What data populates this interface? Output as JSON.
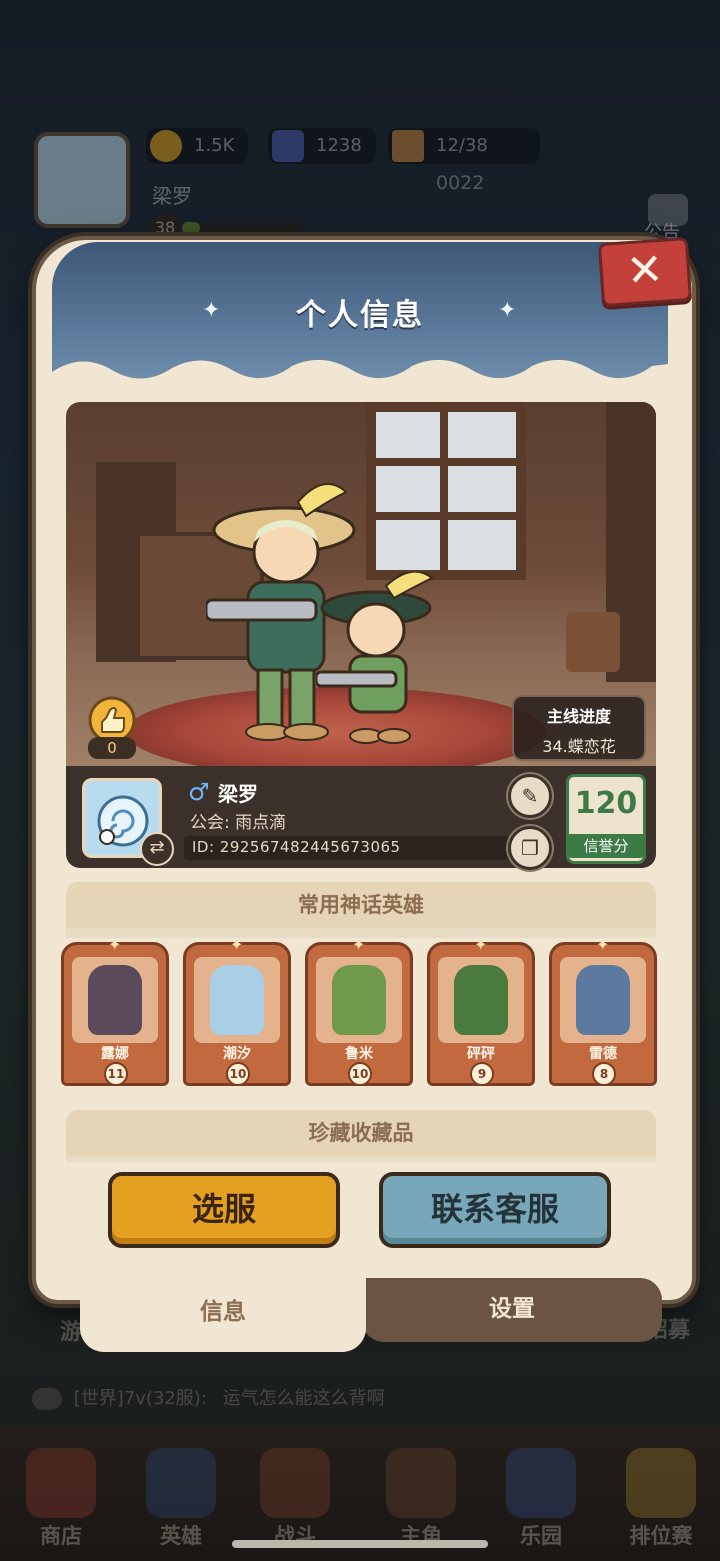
{
  "hud": {
    "coins": "1.5K",
    "stars": "1238",
    "energy": "12/38",
    "timer": "0022",
    "player_name": "梁罗",
    "level": "38",
    "announcement_label": "公告"
  },
  "modal": {
    "title": "个人信息",
    "likes": "0",
    "main_progress_label": "主线进度",
    "main_progress_value": "34.蝶恋花",
    "profile": {
      "gender_symbol": "♂",
      "name": "梁罗",
      "guild": "公会: 雨点滴",
      "id": "ID: 292567482445673065"
    },
    "credit": {
      "value": "120",
      "label": "信誉分"
    },
    "heroes_section_title": "常用神话英雄",
    "heroes": [
      {
        "name": "露娜",
        "level": "11"
      },
      {
        "name": "潮汐",
        "level": "10"
      },
      {
        "name": "鲁米",
        "level": "10"
      },
      {
        "name": "砰砰",
        "level": "9"
      },
      {
        "name": "雷德",
        "level": "8"
      }
    ],
    "collection_section_title": "珍藏收藏品",
    "buttons": {
      "select_server": "选服",
      "contact_support": "联系客服"
    },
    "tabs": {
      "info": "信息",
      "settings": "设置"
    }
  },
  "chat": {
    "channel": "[世界]7v(32服):",
    "message": "运气怎么能这么背啊"
  },
  "bottom_nav": [
    {
      "label": "商店"
    },
    {
      "label": "英雄"
    },
    {
      "label": "战斗"
    },
    {
      "label": "主角"
    },
    {
      "label": "乐园"
    },
    {
      "label": "排位赛"
    }
  ],
  "background_labels": {
    "left_tab": "游",
    "right_tab": "招募"
  },
  "colors": {
    "modal_bg": "#f1e6d2",
    "header_blue": "#4d6b8d",
    "select_server_btn": "#e4a021",
    "contact_btn": "#77a7b8",
    "credit_green": "#3c7a46",
    "card_orange": "#c2693f"
  }
}
